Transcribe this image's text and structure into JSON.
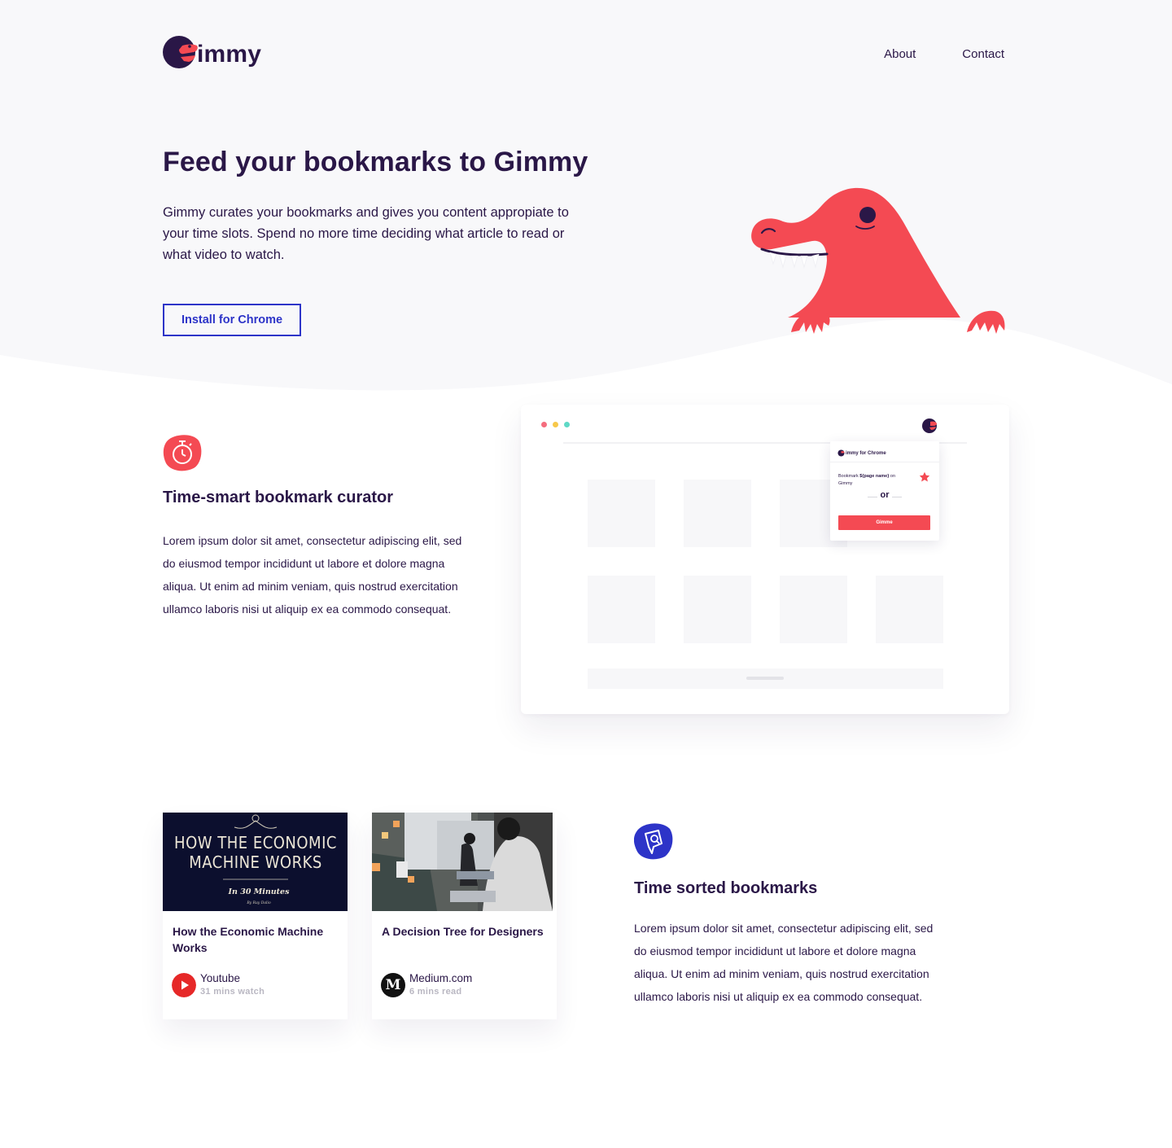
{
  "brand": {
    "name": "immy",
    "initial": "G"
  },
  "nav": {
    "about": "About",
    "contact": "Contact"
  },
  "hero": {
    "title": "Feed your bookmarks to Gimmy",
    "description": "Gimmy curates your bookmarks and gives you content appropiate to your time slots. Spend no more time deciding what article to read or what video to watch.",
    "cta": "Install for Chrome"
  },
  "feature_curator": {
    "title": "Time-smart bookmark curator",
    "text": "Lorem ipsum dolor sit amet, consectetur adipiscing elit, sed do eiusmod tempor incididunt ut labore et dolore magna aliqua. Ut enim ad minim veniam, quis nostrud exercitation ullamco laboris nisi ut aliquip ex ea commodo consequat."
  },
  "browser_mock": {
    "popup_brand": "immy for Chrome",
    "popup_text_prefix": "Bookmark ",
    "popup_text_bold": "${page name}",
    "popup_text_suffix": " on Gimmy",
    "popup_or": "or",
    "popup_button": "Gimme"
  },
  "cards": [
    {
      "title": "How the Economic Machine Works",
      "thumb_line1": "HOW THE ECONOMIC",
      "thumb_line2": "MACHINE WORKS",
      "thumb_line3": "In 30 Minutes",
      "thumb_line4": "By Ray Dalio",
      "source": "Youtube",
      "meta": "31 mins watch",
      "icon": "youtube-play-icon"
    },
    {
      "title": "A Decision Tree for Designers",
      "source": "Medium.com",
      "meta": "6 mins read",
      "icon": "medium-m-icon",
      "icon_letter": "M"
    }
  ],
  "feature_sorted": {
    "title": "Time sorted bookmarks",
    "text": "Lorem ipsum dolor sit amet, consectetur adipiscing elit, sed do eiusmod tempor incididunt ut labore et dolore magna aliqua. Ut enim ad minim veniam, quis nostrud exercitation ullamco laboris nisi ut aliquip ex ea commodo consequat."
  },
  "colors": {
    "brand_red": "#f44a53",
    "brand_navy": "#2a1747",
    "accent_blue": "#2d34c8",
    "hero_bg": "#f8f8fa",
    "dot_red": "#f56d7e",
    "dot_yellow": "#f7c84a",
    "dot_teal": "#5fd9c6"
  }
}
